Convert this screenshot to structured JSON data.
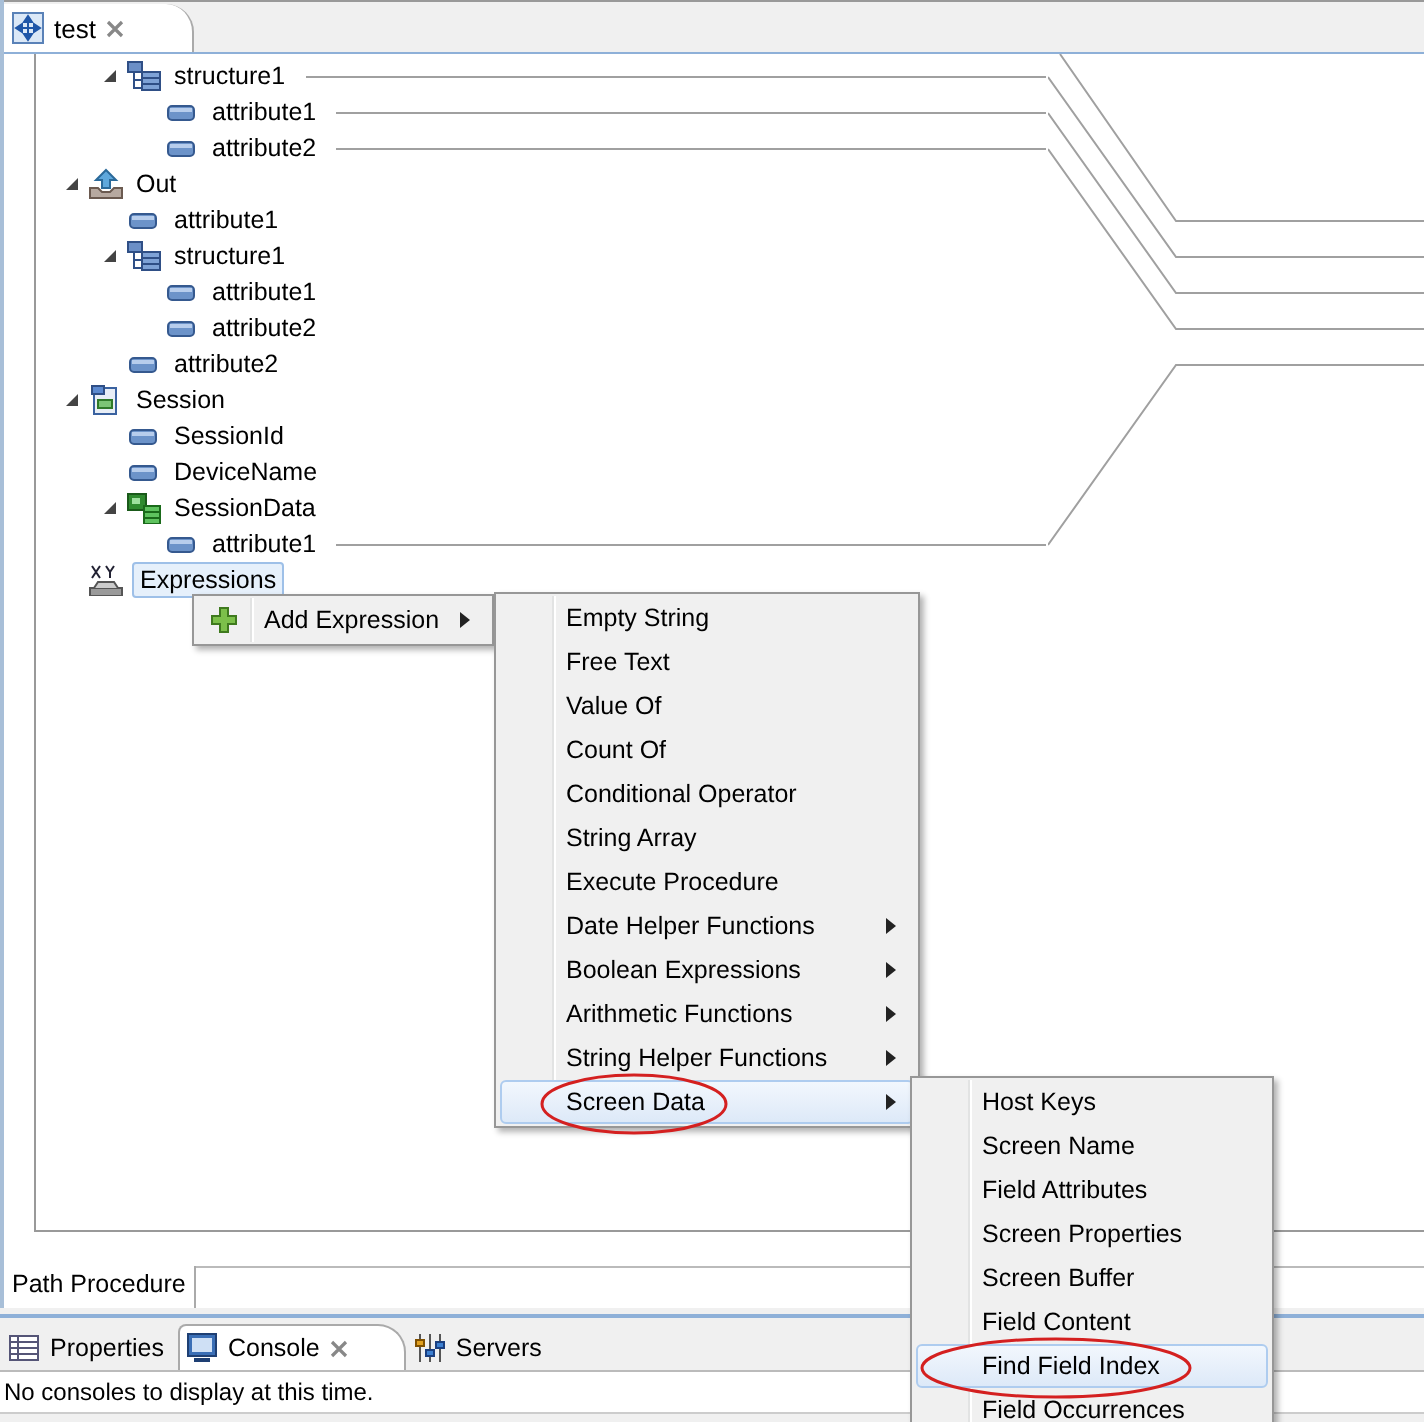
{
  "editor_tab": {
    "label": "test",
    "selected": true
  },
  "tree": {
    "items": [
      {
        "children": [
          {
            "kind": "structure",
            "label": "structure1",
            "expanded": true,
            "selected": false,
            "mapped": true,
            "children": [
              {
                "kind": "attribute",
                "label": "attribute1",
                "selected": false,
                "mapped": true
              },
              {
                "kind": "attribute",
                "label": "attribute2",
                "selected": false,
                "mapped": true
              }
            ]
          }
        ]
      },
      {
        "kind": "out",
        "label": "Out",
        "expanded": true,
        "selected": false,
        "mapped": false,
        "children": [
          {
            "kind": "attribute",
            "label": "attribute1",
            "selected": false,
            "mapped": false
          },
          {
            "kind": "structure",
            "label": "structure1",
            "expanded": true,
            "selected": false,
            "mapped": false,
            "children": [
              {
                "kind": "attribute",
                "label": "attribute1",
                "selected": false,
                "mapped": false
              },
              {
                "kind": "attribute",
                "label": "attribute2",
                "selected": false,
                "mapped": false
              }
            ]
          },
          {
            "kind": "attribute",
            "label": "attribute2",
            "selected": false,
            "mapped": false
          }
        ]
      },
      {
        "kind": "session",
        "label": "Session",
        "expanded": true,
        "selected": false,
        "mapped": false,
        "children": [
          {
            "kind": "attribute",
            "label": "SessionId",
            "selected": false,
            "mapped": false
          },
          {
            "kind": "attribute",
            "label": "DeviceName",
            "selected": false,
            "mapped": false
          },
          {
            "kind": "session-data",
            "label": "SessionData",
            "expanded": true,
            "selected": false,
            "mapped": false,
            "children": [
              {
                "kind": "attribute",
                "label": "attribute1",
                "selected": false,
                "mapped": true
              }
            ]
          }
        ]
      },
      {
        "kind": "expressions",
        "label": "Expressions",
        "selected": true,
        "mapped": false
      }
    ]
  },
  "context_menu": {
    "items": [
      {
        "label": "Add Expression",
        "icon": true,
        "submenu": true,
        "selected": false,
        "annotated": false
      }
    ]
  },
  "submenu": {
    "items": [
      {
        "label": "Empty String",
        "submenu": false,
        "selected": false,
        "annotated": false
      },
      {
        "label": "Free Text",
        "submenu": false,
        "selected": false,
        "annotated": false
      },
      {
        "label": "Value Of",
        "submenu": false,
        "selected": false,
        "annotated": false
      },
      {
        "label": "Count Of",
        "submenu": false,
        "selected": false,
        "annotated": false
      },
      {
        "label": "Conditional Operator",
        "submenu": false,
        "selected": false,
        "annotated": false
      },
      {
        "label": "String Array",
        "submenu": false,
        "selected": false,
        "annotated": false
      },
      {
        "label": "Execute Procedure",
        "submenu": false,
        "selected": false,
        "annotated": false
      },
      {
        "label": "Date Helper Functions",
        "submenu": true,
        "selected": false,
        "annotated": false
      },
      {
        "label": "Boolean Expressions",
        "submenu": true,
        "selected": false,
        "annotated": false
      },
      {
        "label": "Arithmetic Functions",
        "submenu": true,
        "selected": false,
        "annotated": false
      },
      {
        "label": "String Helper Functions",
        "submenu": true,
        "selected": false,
        "annotated": false
      },
      {
        "label": "Screen Data",
        "submenu": true,
        "selected": true,
        "annotated": true
      }
    ]
  },
  "submenu_2": {
    "items": [
      {
        "label": "Host Keys",
        "submenu": false,
        "selected": false,
        "annotated": false
      },
      {
        "label": "Screen Name",
        "submenu": false,
        "selected": false,
        "annotated": false
      },
      {
        "label": "Field Attributes",
        "submenu": false,
        "selected": false,
        "annotated": false
      },
      {
        "label": "Screen Properties",
        "submenu": false,
        "selected": false,
        "annotated": false
      },
      {
        "label": "Screen Buffer",
        "submenu": false,
        "selected": false,
        "annotated": false
      },
      {
        "label": "Field Content",
        "submenu": false,
        "selected": false,
        "annotated": false
      },
      {
        "label": "Find Field Index",
        "submenu": false,
        "selected": true,
        "annotated": true
      },
      {
        "label": "Field Occurrences",
        "submenu": false,
        "selected": false,
        "annotated": false
      }
    ]
  },
  "editor_bottom_tabs": [
    {
      "label": "Path Procedure",
      "selected": true
    }
  ],
  "panel_tabs": [
    {
      "kind": "properties",
      "label": "Properties",
      "selected": false,
      "closable": false
    },
    {
      "kind": "console",
      "label": "Console",
      "selected": true,
      "closable": true
    },
    {
      "kind": "servers",
      "label": "Servers",
      "selected": false,
      "closable": false
    }
  ],
  "console_message": "No consoles to display at this time."
}
